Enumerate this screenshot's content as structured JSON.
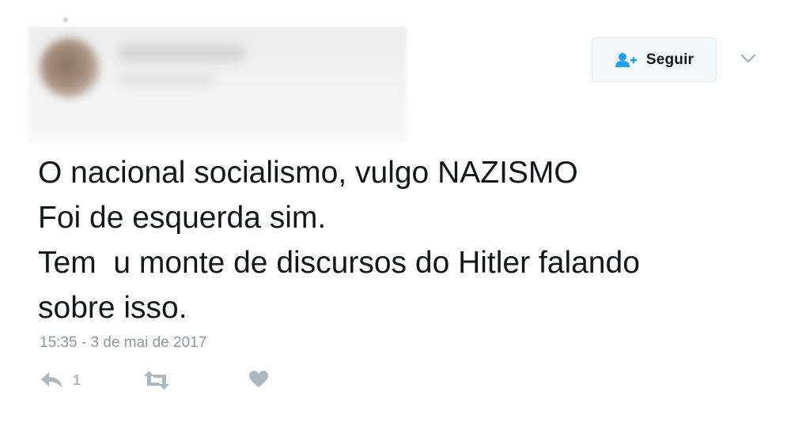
{
  "header": {
    "follow_label": "Seguir"
  },
  "tweet": {
    "lines": [
      "O nacional socialismo, vulgo NAZISMO",
      "Foi de esquerda sim.",
      "Tem  u monte de discursos do Hitler falando",
      "sobre isso."
    ],
    "timestamp": "15:35 - 3 de mai de 2017"
  },
  "actions": {
    "reply_count": "1",
    "icons": [
      "reply-icon",
      "retweet-icon",
      "like-icon"
    ]
  },
  "colors": {
    "text": "#14171a",
    "muted": "#8899a6",
    "icon": "#aab8c2",
    "accent": "#1da1f2"
  }
}
